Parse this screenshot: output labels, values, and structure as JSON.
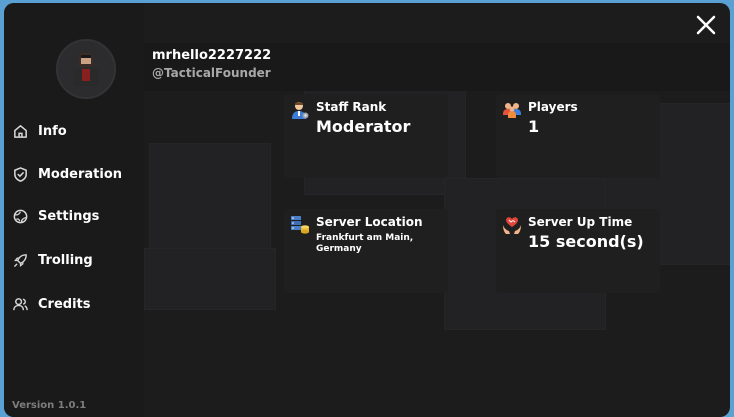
{
  "profile": {
    "username": "mrhello2227222",
    "handle": "@TacticalFounder"
  },
  "nav": {
    "info": "Info",
    "moderation": "Moderation",
    "settings": "Settings",
    "trolling": "Trolling",
    "credits": "Credits"
  },
  "version": "Version 1.0.1",
  "cards": {
    "staff_rank": {
      "title": "Staff Rank",
      "value": "Moderator"
    },
    "players": {
      "title": "Players",
      "value": "1"
    },
    "server_location": {
      "title": "Server Location",
      "value": "Frankfurt am Main, Germany"
    },
    "server_uptime": {
      "title": "Server Up Time",
      "value": "15 second(s)"
    }
  },
  "icons": {
    "close": "close-icon",
    "home": "home-icon",
    "shield": "shield-icon",
    "settings": "globe-icon",
    "trolling": "rocket-icon",
    "credits": "users-icon"
  }
}
